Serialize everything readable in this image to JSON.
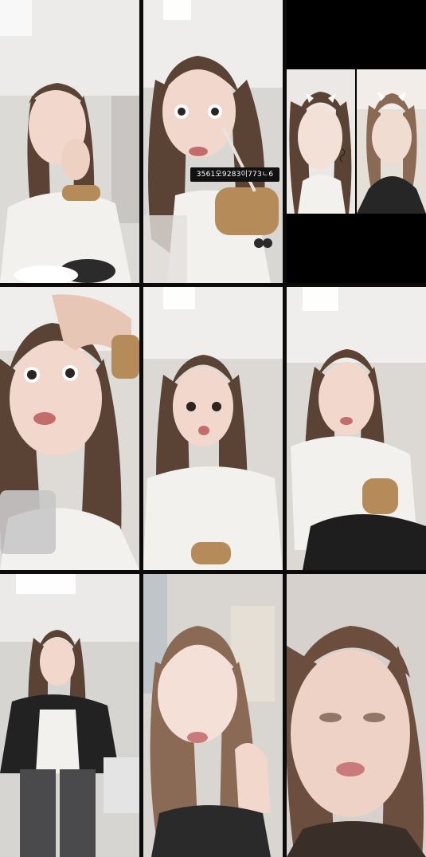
{
  "grid": {
    "background": "#0b0b0b",
    "tiles": [
      {
        "name": "tile-1",
        "caption": null
      },
      {
        "name": "tile-2",
        "caption": "3561오9283이773ㄴ6"
      },
      {
        "name": "tile-3",
        "caption": null
      },
      {
        "name": "tile-4",
        "caption": null
      },
      {
        "name": "tile-5",
        "caption": null
      },
      {
        "name": "tile-6",
        "caption": null
      },
      {
        "name": "tile-7",
        "caption": null
      },
      {
        "name": "tile-8",
        "caption": null
      },
      {
        "name": "tile-9",
        "caption": null
      }
    ]
  },
  "colors": {
    "wall": "#e9e7e4",
    "ceiling": "#d9d7d4",
    "hair": "#5a4334",
    "skin": "#f1d7cc",
    "white_top": "#f3f1ee",
    "black_top": "#222222",
    "leopard": "#b58b5a"
  }
}
